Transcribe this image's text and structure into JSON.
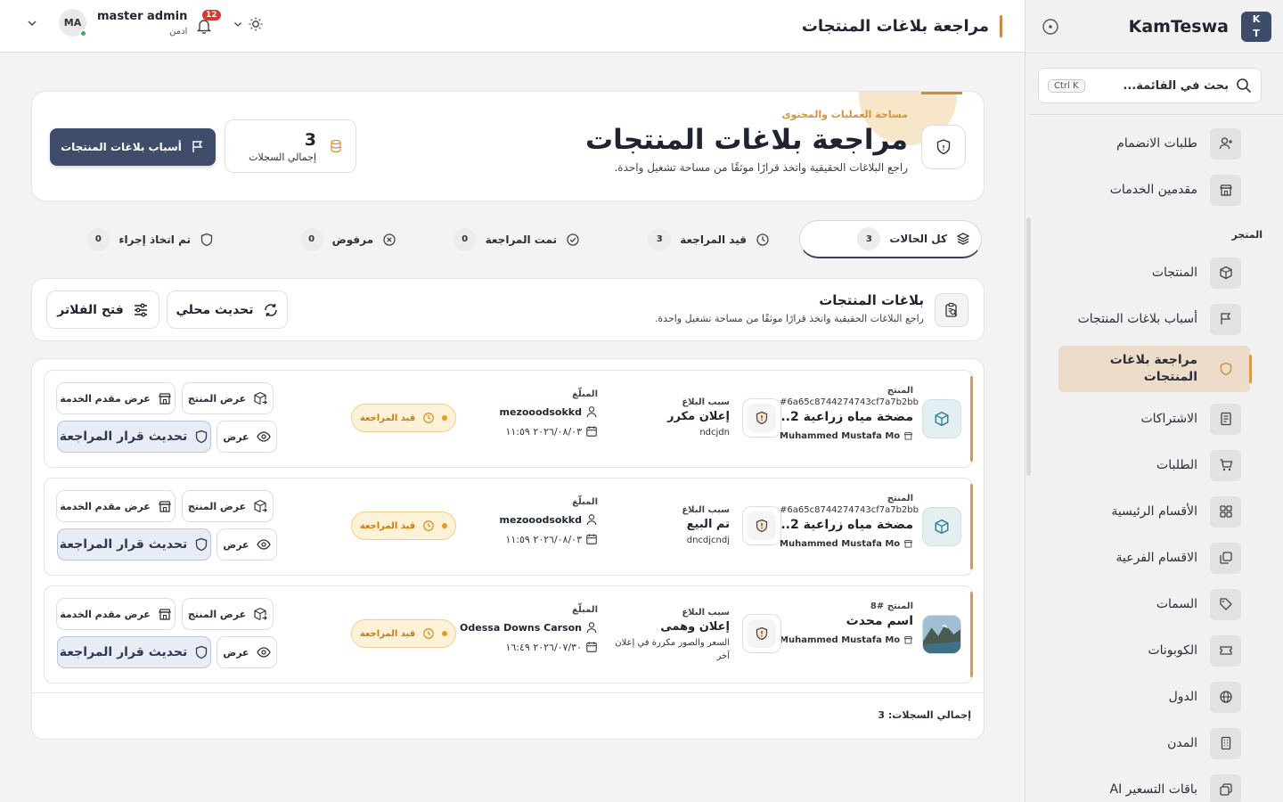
{
  "colors": {
    "accent": "#d79a4c",
    "primary": "#3f4c6a",
    "warning": "#e89b1f"
  },
  "sidebar": {
    "brand": "KamTeswa",
    "badge_line1": "K",
    "badge_line2": "T",
    "search_placeholder": "بحث في القائمة...",
    "search_shortcut": "Ctrl K",
    "items": [
      {
        "label": "طلبات الانضمام",
        "icon": "user-plus-icon"
      },
      {
        "label": "مقدمين الخدمات",
        "icon": "store-icon"
      }
    ],
    "section_store": "المتجر",
    "store_items": [
      {
        "label": "المنتجات",
        "icon": "box-icon"
      },
      {
        "label": "أسباب بلاغات المنتجات",
        "icon": "flag-icon"
      },
      {
        "label": "مراجعة بلاغات المنتجات",
        "icon": "shield-icon",
        "active": true
      },
      {
        "label": "الاشتراكات",
        "icon": "receipt-icon"
      },
      {
        "label": "الطلبات",
        "icon": "cart-icon"
      },
      {
        "label": "الأقسام الرئيسية",
        "icon": "grid-icon"
      },
      {
        "label": "الاقسام الفرعية",
        "icon": "layers-icon"
      },
      {
        "label": "السمات",
        "icon": "tag-icon"
      },
      {
        "label": "الكوبونات",
        "icon": "ticket-icon"
      },
      {
        "label": "الدول",
        "icon": "globe-icon"
      },
      {
        "label": "المدن",
        "icon": "building-icon"
      },
      {
        "label": "باقات التسعير AI",
        "icon": "copy-icon"
      }
    ]
  },
  "topbar": {
    "title": "مراجعة بلاغات المنتجات",
    "user_initials": "MA",
    "user_name": "master admin",
    "user_role": "ادمن",
    "notifications": "12"
  },
  "hero": {
    "eyebrow": "مساحة العمليات والمحتوى",
    "title": "مراجعة بلاغات المنتجات",
    "description": "راجع البلاغات الحقيقية واتخذ قرارًا موثقًا من مساحة تشغيل واحدة.",
    "stat_value": "3",
    "stat_label": "إجمالي السجلات",
    "button": "أسباب بلاغات المنتجات"
  },
  "tabs": [
    {
      "label": "كل الحالات",
      "count": "3",
      "icon": "layers-icon"
    },
    {
      "label": "قيد المراجعة",
      "count": "3",
      "icon": "clock-icon"
    },
    {
      "label": "تمت المراجعة",
      "count": "0",
      "icon": "check-circle-icon"
    },
    {
      "label": "مرفوض",
      "count": "0",
      "icon": "x-circle-icon"
    },
    {
      "label": "تم اتخاذ إجراء",
      "count": "0",
      "icon": "shield-icon"
    }
  ],
  "section": {
    "title": "بلاغات المنتجات",
    "description": "راجع البلاغات الحقيقية واتخذ قرارًا موثقًا من مساحة تشغيل واحدة.",
    "refresh": "تحديث محلي",
    "filters": "فتح الفلاتر"
  },
  "table": {
    "labels": {
      "product": "المنتج",
      "reason": "سبب البلاغ",
      "reporter": "المبلّغ"
    },
    "actions": {
      "view_product": "عرض المنتج",
      "view_provider": "عرض مقدم الخدمة",
      "view": "عرض",
      "update": "تحديث قرار المراجعة"
    },
    "rows": [
      {
        "product_id": "#6a65c8744274743cf7a7b2bb",
        "product_name": "مضخة مياه زراعية 2...",
        "vendor": "Muhammed Mustafa Mo",
        "reason": "إعلان مكرر",
        "reason_note": "ndcjdn",
        "reporter": "mezooodsokkd",
        "date": "٢٠٢٦/٠٨/٠٣ ١١:٥٩",
        "status": "قيد المراجعة",
        "thumb": "box"
      },
      {
        "product_id": "#6a65c8744274743cf7a7b2bb",
        "product_name": "مضخة مياه زراعية 2...",
        "vendor": "Muhammed Mustafa Mo",
        "reason": "تم البيع",
        "reason_note": "dncdjcndj",
        "reporter": "mezooodsokkd",
        "date": "٢٠٢٦/٠٨/٠٣ ١١:٥٩",
        "status": "قيد المراجعة",
        "thumb": "box"
      },
      {
        "product_id": "المنتج #8",
        "product_name": "اسم محدث",
        "vendor": "Muhammed Mustafa Mo",
        "reason": "إعلان وهمى",
        "reason_note": "السعر والصور مكررة في إعلان آخر",
        "reporter": "Odessa Downs Carson",
        "date": "٢٠٢٦/٠٧/٣٠ ١٦:٤٩",
        "status": "قيد المراجعة",
        "thumb": "photo"
      }
    ],
    "footer": "إجمالي السجلات: 3"
  }
}
